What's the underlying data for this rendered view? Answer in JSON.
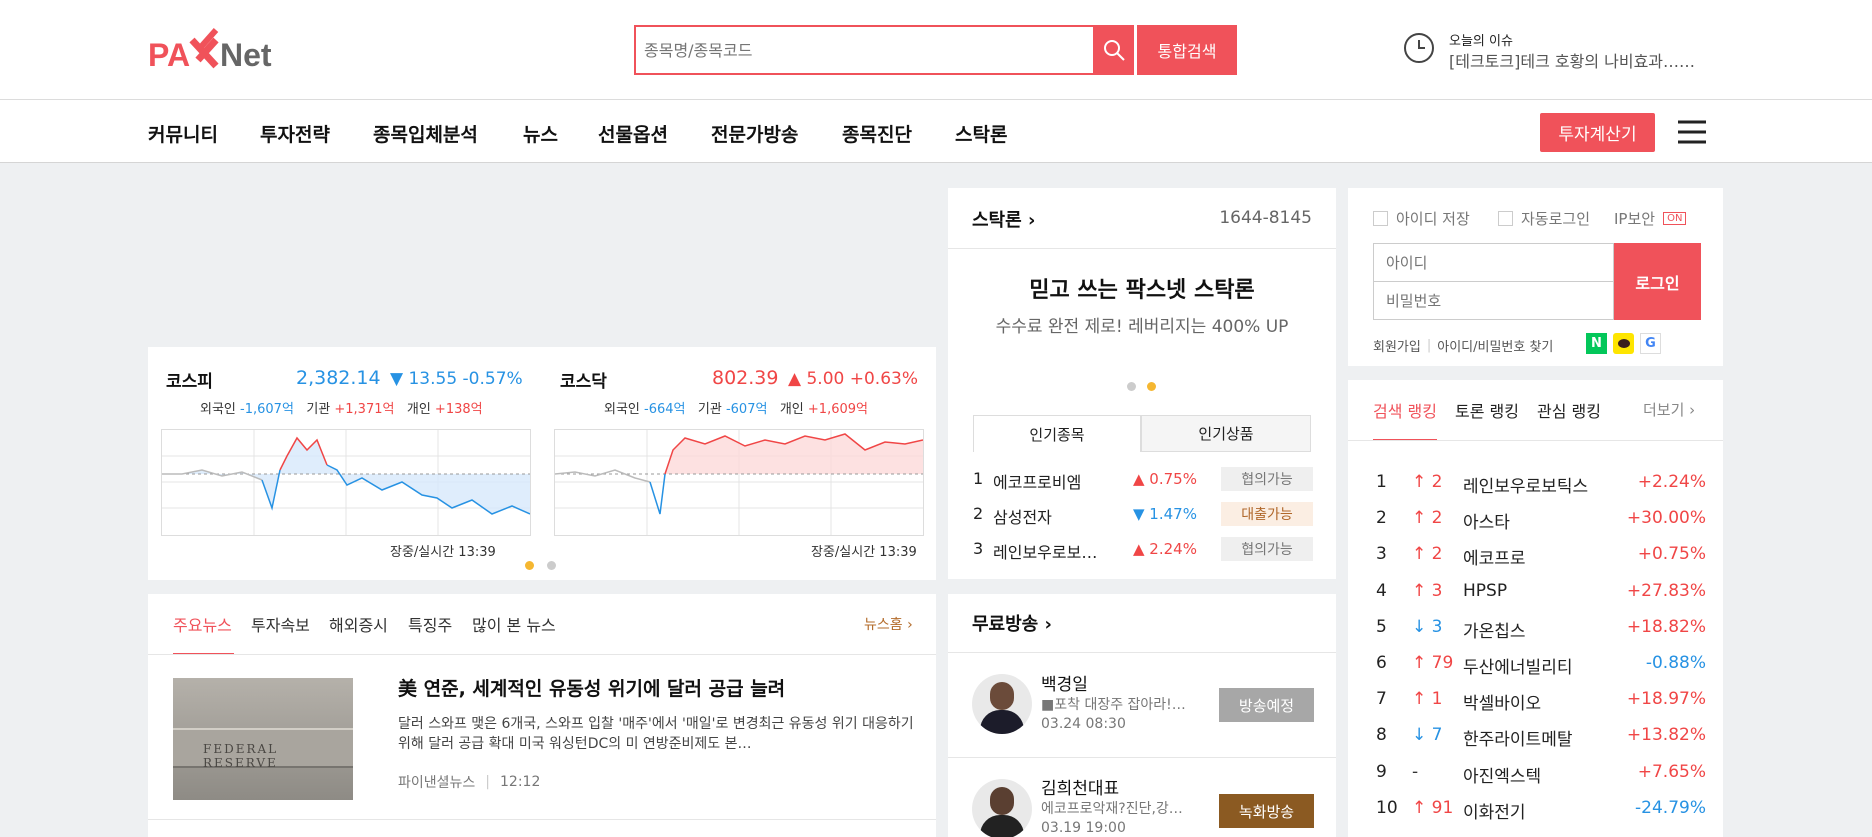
{
  "header": {
    "logo": "PAXNet",
    "search_placeholder": "종목명/종목코드",
    "search_button": "통합검색",
    "issue_label": "오늘의 이슈",
    "issue_text": "[테크토크]테크 호황의 나비효과……"
  },
  "nav": {
    "items": [
      "커뮤니티",
      "투자전략",
      "종목입체분석",
      "뉴스",
      "선물옵션",
      "전문가방송",
      "종목진단",
      "스탁론"
    ],
    "calc_button": "투자계산기"
  },
  "indices": [
    {
      "name": "코스피",
      "value": "2,382.14",
      "change": "▼ 13.55 -0.57%",
      "direction": "down",
      "investors": [
        {
          "label": "외국인",
          "value": "-1,607억",
          "dir": "down"
        },
        {
          "label": "기관",
          "value": "+1,371억",
          "dir": "up"
        },
        {
          "label": "개인",
          "value": "+138억",
          "dir": "up"
        }
      ],
      "status": "장중/실시간 13:39"
    },
    {
      "name": "코스닥",
      "value": "802.39",
      "change": "▲ 5.00 +0.63%",
      "direction": "up",
      "investors": [
        {
          "label": "외국인",
          "value": "-664억",
          "dir": "down"
        },
        {
          "label": "기관",
          "value": "-607억",
          "dir": "down"
        },
        {
          "label": "개인",
          "value": "+1,609억",
          "dir": "up"
        }
      ],
      "status": "장중/실시간 13:39"
    }
  ],
  "news": {
    "tabs": [
      "주요뉴스",
      "투자속보",
      "해외증시",
      "특징주",
      "많이 본 뉴스"
    ],
    "home_link": "뉴스홈",
    "article": {
      "title": "美 연준, 세계적인 유동성 위기에 달러 공급 늘려",
      "summary": "달러 스와프 맺은 6개국, 스와프 입찰 '매주'에서 '매일'로 변경최근 유동성 위기 대응하기 위해 달러 공급 확대 미국 워싱턴DC의 미 연방준비제도 본…",
      "source": "파이낸셜뉴스",
      "time": "12:12",
      "image_text": "FEDERAL RESERVE"
    }
  },
  "stockloan": {
    "title": "스탁론",
    "phone": "1644-8145",
    "headline": "믿고 쓰는 팍스넷 스탁론",
    "subline": "수수료 완전 제로! 레버리지는 400% UP",
    "tabs": [
      "인기종목",
      "인기상품"
    ],
    "items": [
      {
        "rank": "1",
        "name": "에코프로비엠",
        "change": "▲ 0.75%",
        "dir": "up",
        "status": "협의가능"
      },
      {
        "rank": "2",
        "name": "삼성전자",
        "change": "▼ 1.47%",
        "dir": "down",
        "status": "대출가능"
      },
      {
        "rank": "3",
        "name": "레인보우로보…",
        "change": "▲ 2.24%",
        "dir": "up",
        "status": "협의가능"
      }
    ]
  },
  "broadcast": {
    "title": "무료방송",
    "items": [
      {
        "name": "백경일",
        "desc": "■포착 대장주 잡아라!…",
        "time": "03.24 08:30",
        "status": "방송예정",
        "color": "#a7a7a7"
      },
      {
        "name": "김희천대표",
        "desc": "에코프로악재?진단,강…",
        "time": "03.19 19:00",
        "status": "녹화방송",
        "color": "#8b5a22"
      }
    ]
  },
  "login": {
    "save_id": "아이디 저장",
    "auto_login": "자동로그인",
    "ip_security": "IP보안",
    "ip_state": "ON",
    "id_placeholder": "아이디",
    "pw_placeholder": "비밀번호",
    "login_button": "로그인",
    "signup": "회원가입",
    "find": "아이디/비밀번호 찾기"
  },
  "ranking": {
    "tabs": [
      "검색 랭킹",
      "토론 랭킹",
      "관심 랭킹"
    ],
    "more": "더보기",
    "rows": [
      {
        "rank": "1",
        "move": "↑ 2",
        "mdir": "up",
        "name": "레인보우로보틱스",
        "change": "+2.24%",
        "cdir": "up"
      },
      {
        "rank": "2",
        "move": "↑ 2",
        "mdir": "up",
        "name": "아스타",
        "change": "+30.00%",
        "cdir": "up"
      },
      {
        "rank": "3",
        "move": "↑ 2",
        "mdir": "up",
        "name": "에코프로",
        "change": "+0.75%",
        "cdir": "up"
      },
      {
        "rank": "4",
        "move": "↑ 3",
        "mdir": "up",
        "name": "HPSP",
        "change": "+27.83%",
        "cdir": "up"
      },
      {
        "rank": "5",
        "move": "↓ 3",
        "mdir": "down",
        "name": "가온칩스",
        "change": "+18.82%",
        "cdir": "up"
      },
      {
        "rank": "6",
        "move": "↑ 79",
        "mdir": "up",
        "name": "두산에너빌리티",
        "change": "-0.88%",
        "cdir": "down"
      },
      {
        "rank": "7",
        "move": "↑ 1",
        "mdir": "up",
        "name": "박셀바이오",
        "change": "+18.97%",
        "cdir": "up"
      },
      {
        "rank": "8",
        "move": "↓ 7",
        "mdir": "down",
        "name": "한주라이트메탈",
        "change": "+13.82%",
        "cdir": "up"
      },
      {
        "rank": "9",
        "move": "-",
        "mdir": "none",
        "name": "아진엑스텍",
        "change": "+7.65%",
        "cdir": "up"
      },
      {
        "rank": "10",
        "move": "↑ 91",
        "mdir": "up",
        "name": "이화전기",
        "change": "-24.79%",
        "cdir": "down"
      }
    ]
  },
  "colors": {
    "accent": "#f0525a",
    "up": "#f04646",
    "down": "#2792e3"
  }
}
